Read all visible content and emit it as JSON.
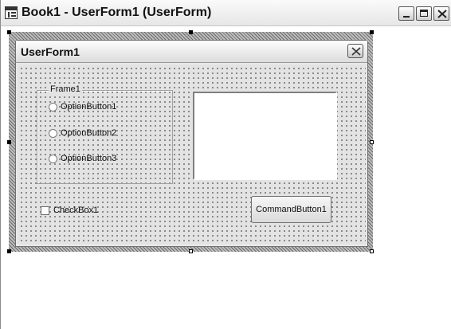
{
  "window": {
    "title": "Book1 - UserForm1 (UserForm)",
    "controls": [
      "minimize-icon",
      "maximize-icon",
      "close-icon"
    ]
  },
  "form": {
    "title": "UserForm1",
    "close_icon": "close-icon",
    "frame": {
      "label": "Frame1",
      "options": [
        {
          "label": "OptionButton1"
        },
        {
          "label": "OptionButton2"
        },
        {
          "label": "OptionButton3"
        }
      ]
    },
    "checkbox": {
      "label": "CheckBox1",
      "checked": false
    },
    "command_button": {
      "label": "CommandButton1"
    },
    "listbox": {
      "items": []
    }
  }
}
